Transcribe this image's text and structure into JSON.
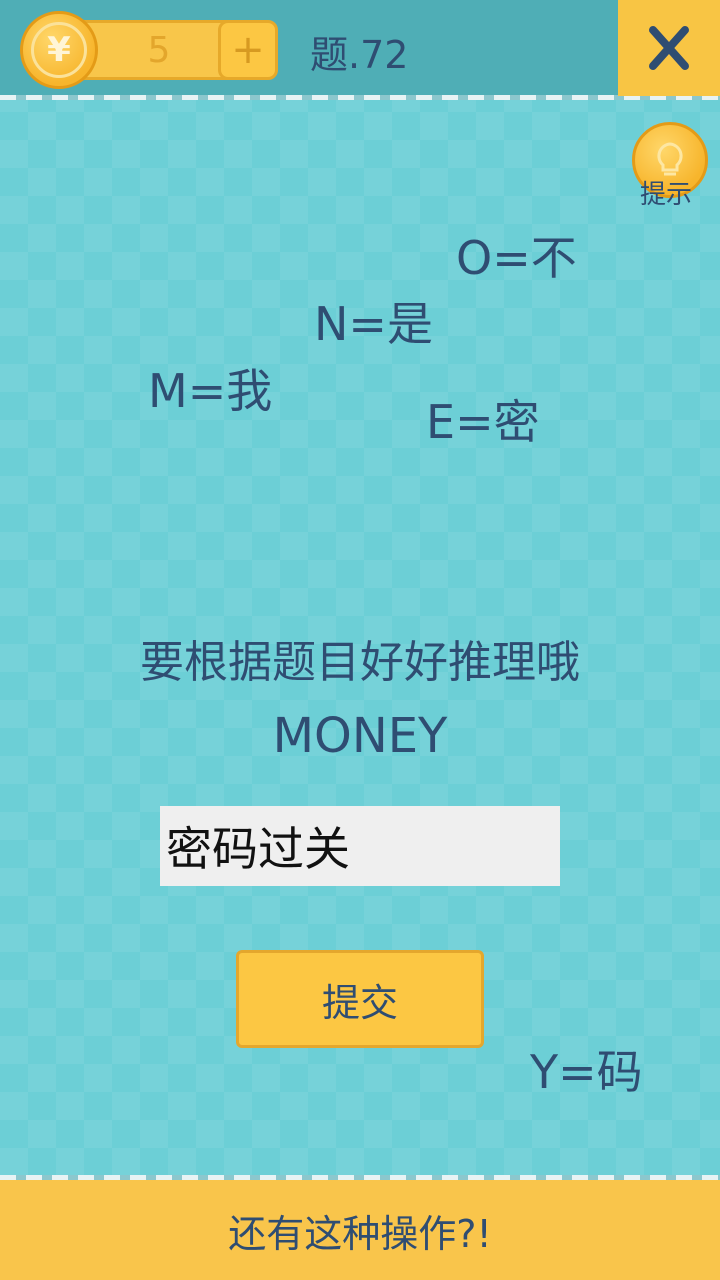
{
  "header": {
    "coin_count": "5",
    "coin_symbol": "¥",
    "add_symbol": "+",
    "level_label": "题.72"
  },
  "hint": {
    "label": "提示"
  },
  "clues": [
    "O=不",
    "N=是",
    "M=我",
    "E=密",
    "Y=码"
  ],
  "question": {
    "text": "要根据题目好好推理哦",
    "word": "MONEY"
  },
  "answer_input": {
    "value": "密码过关"
  },
  "submit_label": "提交",
  "footer_label": "还有这种操作?!",
  "colors": {
    "background": "#6ccfd6",
    "topbar": "#4faeb6",
    "accent_yellow": "#f8c544",
    "text_navy": "#2f4d72"
  }
}
